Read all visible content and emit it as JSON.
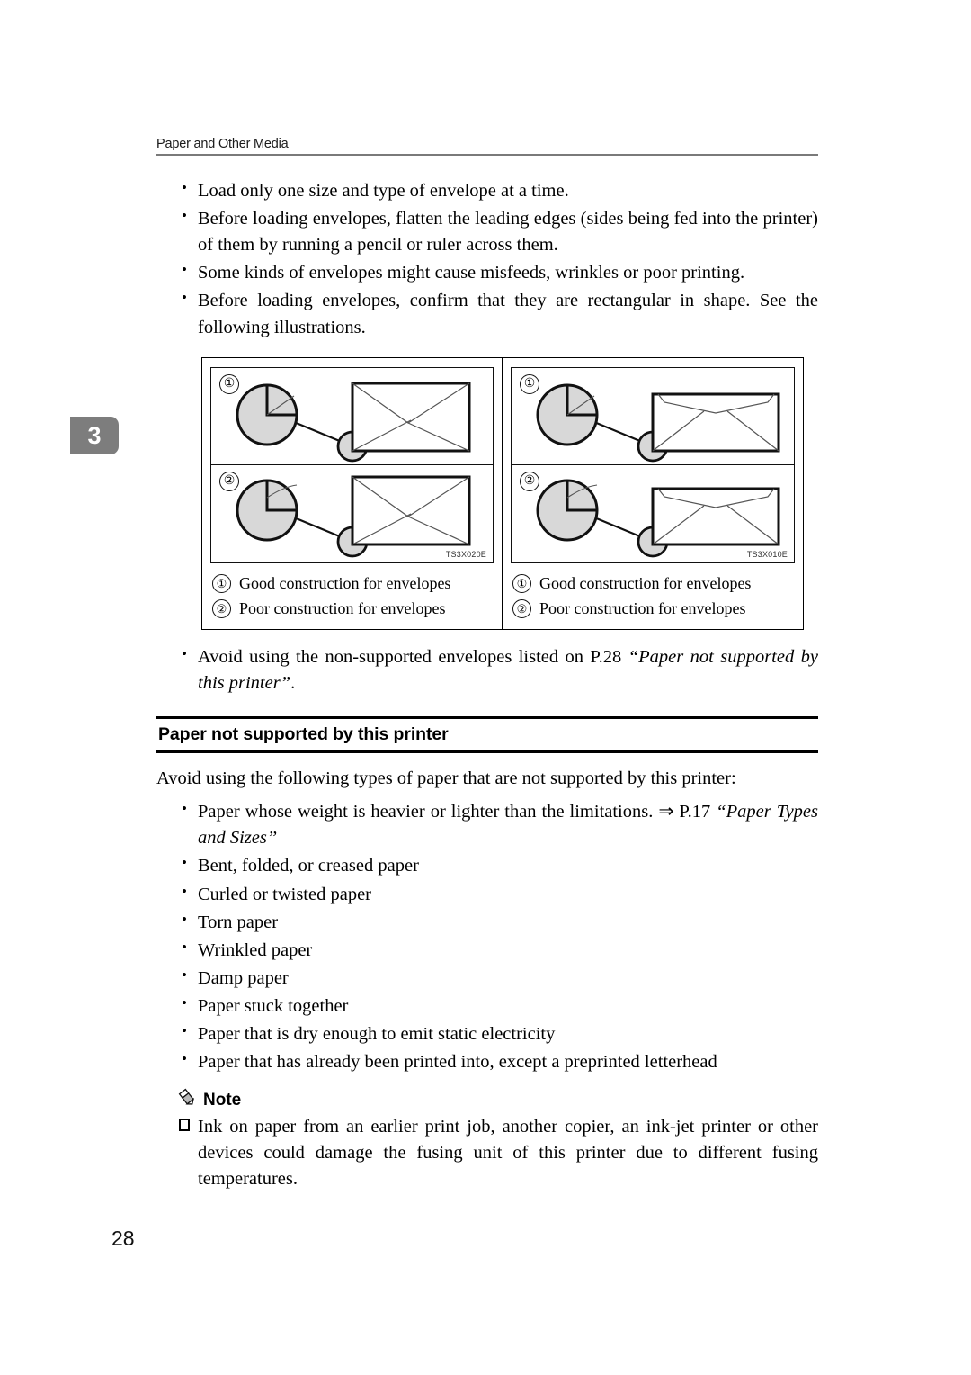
{
  "header": {
    "title": "Paper and Other Media"
  },
  "chapter_tab": {
    "number": "3"
  },
  "envelope_bullets": [
    "Load only one size and type of envelope at a time.",
    "Before loading envelopes, flatten the leading edges (sides being fed into the printer) of them by running a pencil or ruler across them.",
    "Some kinds of envelopes might cause misfeeds, wrinkles or poor printing.",
    "Before loading envelopes, confirm that they are rectangular in shape. See the following illustrations."
  ],
  "figure": {
    "left": {
      "code": "TS3X020E",
      "panels": [
        {
          "num": "①"
        },
        {
          "num": "②"
        }
      ],
      "legend": [
        {
          "num": "①",
          "text": "Good construction for envelopes"
        },
        {
          "num": "②",
          "text": "Poor construction for envelopes"
        }
      ]
    },
    "right": {
      "code": "TS3X010E",
      "panels": [
        {
          "num": "①"
        },
        {
          "num": "②"
        }
      ],
      "legend": [
        {
          "num": "①",
          "text": "Good construction for envelopes"
        },
        {
          "num": "②",
          "text": "Poor construction for envelopes"
        }
      ]
    }
  },
  "avoid_bullet": {
    "lead": "Avoid using the non-supported envelopes listed on P.28 ",
    "ref": "“Paper not supported by this printer”",
    "trail": "."
  },
  "section": {
    "title": "Paper not supported by this printer",
    "intro": "Avoid using the following types of paper that are not supported by this printer:",
    "first_bullet": {
      "lead": "Paper whose weight is heavier or lighter than the limitations. ⇒ P.17 ",
      "ref": "“Paper Types and Sizes”"
    },
    "bullets": [
      "Bent, folded, or creased paper",
      "Curled or twisted paper",
      "Torn paper",
      "Wrinkled paper",
      "Damp paper",
      "Paper stuck together",
      "Paper that is dry enough to emit static electricity",
      "Paper that has already been printed into, except a preprinted letterhead"
    ]
  },
  "note": {
    "label": "Note",
    "items": [
      "Ink on paper from an earlier print job, another copier, an ink-jet printer or other devices could damage the fusing unit of this printer due to different fusing temperatures."
    ]
  },
  "page_number": "28",
  "colors": {
    "tab_gray": "#7d7d7d",
    "rule_gray": "#7a7a7a",
    "magnifier_fill": "#d8d8d8"
  }
}
